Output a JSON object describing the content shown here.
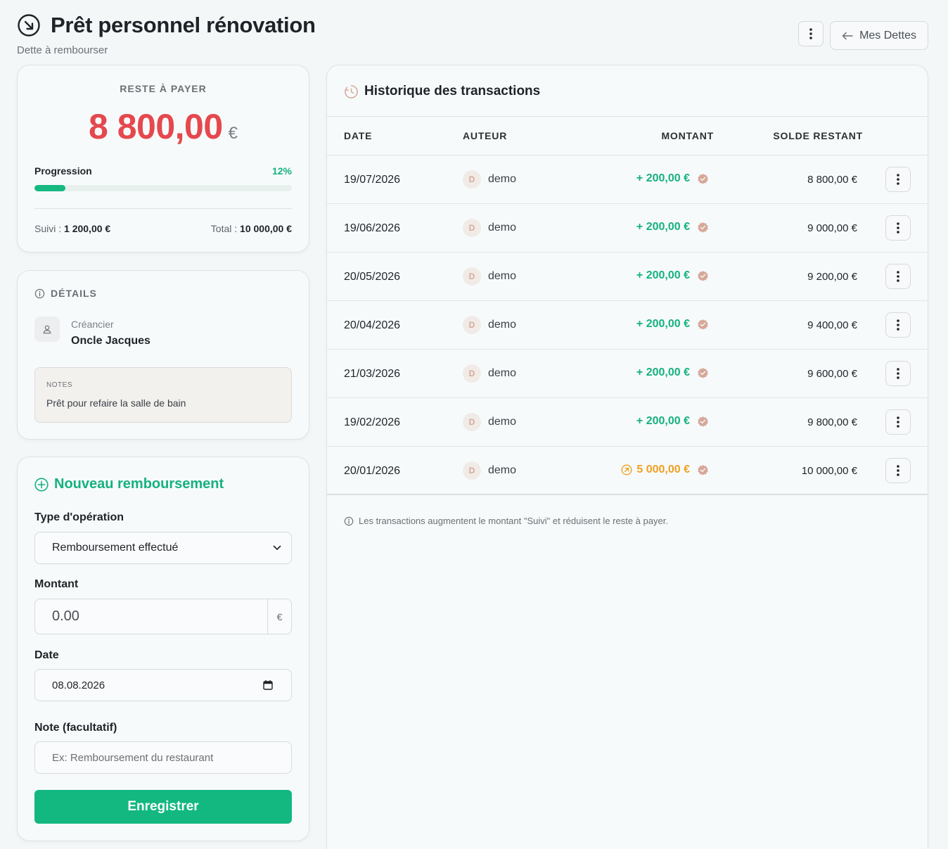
{
  "header": {
    "title": "Prêt personnel rénovation",
    "subtitle": "Dette à rembourser",
    "back_label": "Mes Dettes"
  },
  "summary": {
    "label": "RESTE À PAYER",
    "amount": "8 800,00",
    "currency": "€",
    "progress_label": "Progression",
    "progress_pct": "12%",
    "progress_value": 0.12,
    "suivi_label": "Suivi :",
    "suivi_value": "1 200,00 €",
    "total_label": "Total :",
    "total_value": "10 000,00 €"
  },
  "details": {
    "heading": "DÉTAILS",
    "creditor_label": "Créancier",
    "creditor_name": "Oncle Jacques",
    "notes_label": "NOTES",
    "notes_text": "Prêt pour refaire la salle de bain"
  },
  "form": {
    "title": "Nouveau remboursement",
    "type_label": "Type d'opération",
    "type_value": "Remboursement effectué",
    "amount_label": "Montant",
    "amount_placeholder": "0.00",
    "amount_currency": "€",
    "date_label": "Date",
    "date_value": "08.08.2026",
    "note_label": "Note (facultatif)",
    "note_placeholder": "Ex: Remboursement du restaurant",
    "submit_label": "Enregistrer"
  },
  "history": {
    "title": "Historique des transactions",
    "columns": [
      "DATE",
      "AUTEUR",
      "MONTANT",
      "SOLDE RESTANT"
    ],
    "rows": [
      {
        "date": "19/07/2026",
        "initial": "D",
        "author": "demo",
        "amount": "+ 200,00 €",
        "balance": "8 800,00 €"
      },
      {
        "date": "19/06/2026",
        "initial": "D",
        "author": "demo",
        "amount": "+ 200,00 €",
        "balance": "9 000,00 €"
      },
      {
        "date": "20/05/2026",
        "initial": "D",
        "author": "demo",
        "amount": "+ 200,00 €",
        "balance": "9 200,00 €"
      },
      {
        "date": "20/04/2026",
        "initial": "D",
        "author": "demo",
        "amount": "+ 200,00 €",
        "balance": "9 400,00 €"
      },
      {
        "date": "21/03/2026",
        "initial": "D",
        "author": "demo",
        "amount": "+ 200,00 €",
        "balance": "9 600,00 €"
      },
      {
        "date": "19/02/2026",
        "initial": "D",
        "author": "demo",
        "amount": "+ 200,00 €",
        "balance": "9 800,00 €"
      },
      {
        "date": "20/01/2026",
        "initial": "D",
        "author": "demo",
        "amount": "5 000,00 €",
        "balance": "10 000,00 €"
      }
    ],
    "footer_note": "Les transactions augmentent le montant \"Suivi\" et réduisent le reste à payer."
  },
  "colors": {
    "accent": "#16b17e",
    "danger": "#e5484d",
    "warning": "#f0a020"
  }
}
